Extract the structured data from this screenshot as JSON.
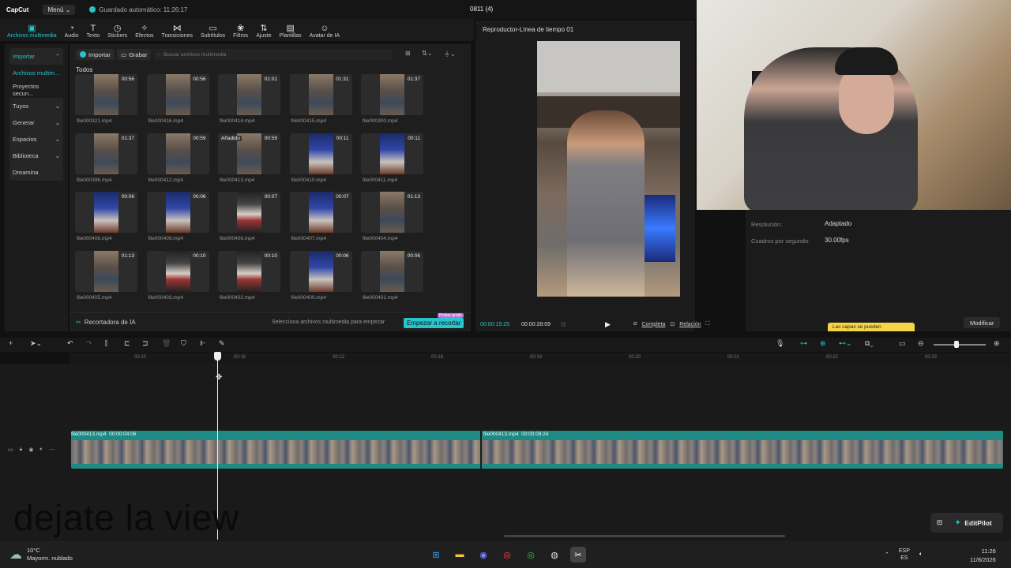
{
  "app": {
    "logo": "CapCut",
    "menu": "Menú",
    "autosave": "Guardado automático: 11:26:17",
    "project_title": "0811 (4)"
  },
  "toolbar": [
    {
      "label": "Archivos multimedia",
      "icon": "media-icon"
    },
    {
      "label": "Audio",
      "icon": "audio-icon"
    },
    {
      "label": "Texto",
      "icon": "text-icon"
    },
    {
      "label": "Stickers",
      "icon": "sticker-icon"
    },
    {
      "label": "Efectos",
      "icon": "effects-icon"
    },
    {
      "label": "Transiciones",
      "icon": "transition-icon"
    },
    {
      "label": "Subtítulos",
      "icon": "subtitle-icon"
    },
    {
      "label": "Filtros",
      "icon": "filter-icon"
    },
    {
      "label": "Ajuste",
      "icon": "adjust-icon"
    },
    {
      "label": "Plantillas",
      "icon": "template-icon"
    },
    {
      "label": "Avatar de IA",
      "icon": "avatar-icon"
    }
  ],
  "sidebar": {
    "items": [
      {
        "label": "Importar"
      },
      {
        "label": "Archivos multim..."
      },
      {
        "label": "Proyectos secun..."
      },
      {
        "label": "Tuyos"
      },
      {
        "label": "Generar",
        "badge": "AI"
      },
      {
        "label": "Espacios"
      },
      {
        "label": "Biblioteca"
      },
      {
        "label": "Dreamina"
      }
    ]
  },
  "media": {
    "import_label": "Importar",
    "record_label": "Grabar",
    "search_placeholder": "Buscar archivos multimedia",
    "section": "Todos",
    "files": [
      {
        "name": "file000321.mp4",
        "duration": "00:56"
      },
      {
        "name": "file000416.mp4",
        "duration": "00:56"
      },
      {
        "name": "file000414.mp4",
        "duration": "01:01"
      },
      {
        "name": "file000415.mp4",
        "duration": "01:31"
      },
      {
        "name": "file000300.mp4",
        "duration": "01:37"
      },
      {
        "name": "file000396.mp4",
        "duration": "01:37"
      },
      {
        "name": "file000412.mp4",
        "duration": "00:59"
      },
      {
        "name": "file000413.mp4",
        "duration": "00:59",
        "badge": "Añadido"
      },
      {
        "name": "file000410.mp4",
        "duration": "00:11"
      },
      {
        "name": "file000411.mp4",
        "duration": "00:11"
      },
      {
        "name": "file000408.mp4",
        "duration": "00:06"
      },
      {
        "name": "file000409.mp4",
        "duration": "00:06"
      },
      {
        "name": "file000406.mp4",
        "duration": "00:07"
      },
      {
        "name": "file000407.mp4",
        "duration": "00:07"
      },
      {
        "name": "file000404.mp4",
        "duration": "01:13"
      },
      {
        "name": "file000405.mp4",
        "duration": "01:13"
      },
      {
        "name": "file000403.mp4",
        "duration": "00:10"
      },
      {
        "name": "file000402.mp4",
        "duration": "00:10"
      },
      {
        "name": "file000400.mp4",
        "duration": "00:06"
      },
      {
        "name": "file000401.mp4",
        "duration": "00:06"
      }
    ],
    "footer_label": "Recortadora de IA",
    "footer_hint": "Selecciona archivos multimedia para empezar",
    "start_button": "Empezar a recortar",
    "promo_badge": "Probar gratis"
  },
  "player": {
    "title": "Reproductor-Línea de tiempo 01",
    "current_time": "00:00:15:25",
    "total_time": "00:00:28:09",
    "full_label": "Completa",
    "ratio_label": "Relación"
  },
  "properties": {
    "resolution_label": "Resolución:",
    "resolution_value": "Adaptado",
    "fps_label": "Cuadros por segundo:",
    "fps_value": "30.00fps",
    "tooltip": "Las capas se pueden",
    "modify_button": "Modificar"
  },
  "timeline": {
    "ticks": [
      "00:10",
      "00:16",
      "00:12",
      "00:18",
      "00:19",
      "00:20",
      "00:21",
      "00:22",
      "00:23"
    ],
    "clips": [
      {
        "name": "file000413.mp4",
        "duration": "00:00:04:06"
      },
      {
        "name": "file000413.mp4",
        "duration": "00:00:09:24"
      }
    ],
    "subtitle_text": "dejate la view",
    "editpilot": "EditPilot"
  },
  "taskbar": {
    "temp": "10°C",
    "weather": "Mayorm. nublado",
    "lang1": "ESP",
    "lang2": "ES",
    "time": "11:26",
    "date": "11/8/2026"
  }
}
